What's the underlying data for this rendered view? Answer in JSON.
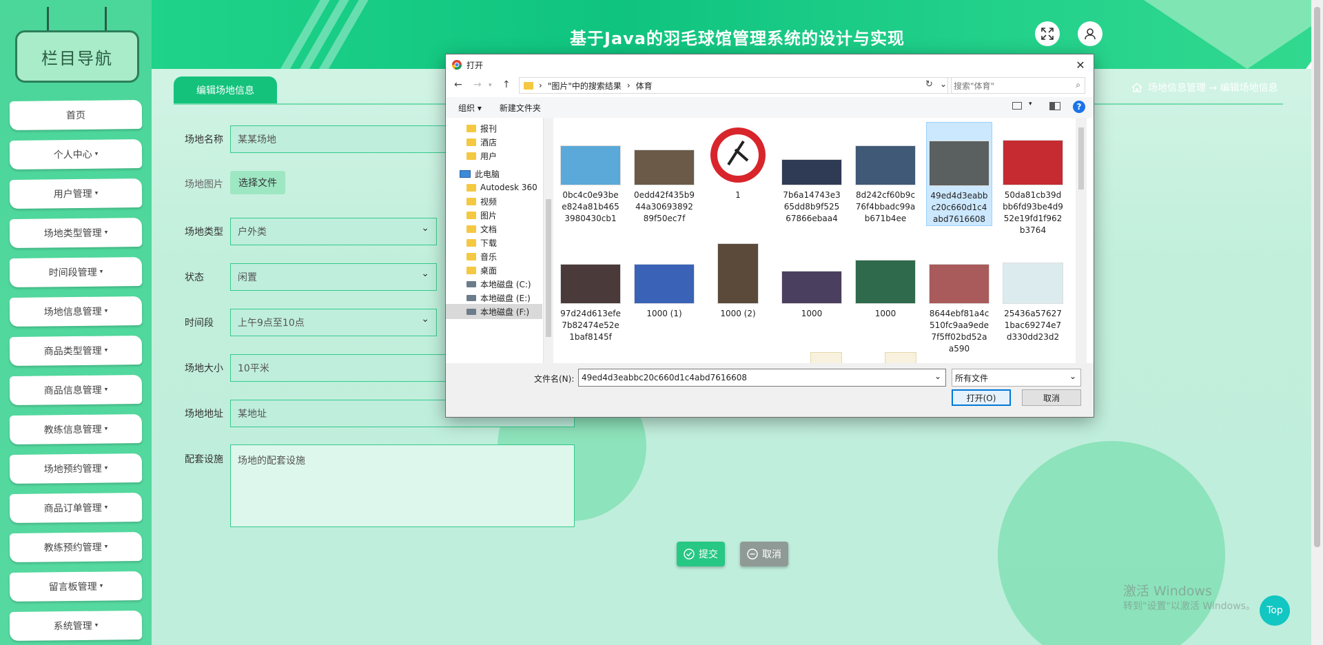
{
  "app": {
    "title": "基于Java的羽毛球馆管理系统的设计与实现"
  },
  "sidebar": {
    "heading": "栏目导航",
    "items": [
      {
        "label": "首页",
        "has_caret": false
      },
      {
        "label": "个人中心",
        "has_caret": true
      },
      {
        "label": "用户管理",
        "has_caret": true
      },
      {
        "label": "场地类型管理",
        "has_caret": true
      },
      {
        "label": "时间段管理",
        "has_caret": true
      },
      {
        "label": "场地信息管理",
        "has_caret": true
      },
      {
        "label": "商品类型管理",
        "has_caret": true
      },
      {
        "label": "商品信息管理",
        "has_caret": true
      },
      {
        "label": "教练信息管理",
        "has_caret": true
      },
      {
        "label": "场地预约管理",
        "has_caret": true
      },
      {
        "label": "商品订单管理",
        "has_caret": true
      },
      {
        "label": "教练预约管理",
        "has_caret": true
      },
      {
        "label": "留言板管理",
        "has_caret": true
      },
      {
        "label": "系统管理",
        "has_caret": true
      }
    ],
    "caret": "▾"
  },
  "tab": {
    "label": "编辑场地信息"
  },
  "breadcrumb": {
    "text": "场地信息管理 → 编辑场地信息"
  },
  "form": {
    "name_label": "场地名称",
    "name_value": "某某场地",
    "image_label": "场地图片",
    "file_button": "选择文件",
    "type_label": "场地类型",
    "type_value": "户外类",
    "status_label": "状态",
    "status_value": "闲置",
    "time_label": "时间段",
    "time_value": "上午9点至10点",
    "size_label": "场地大小",
    "size_value": "10平米",
    "address_label": "场地地址",
    "address_value": "某地址",
    "facilities_label": "配套设施",
    "facilities_value": "场地的配套设施",
    "submit": "提交",
    "cancel": "取消"
  },
  "watermark": {
    "line1": "激活 Windows",
    "line2": "转到\"设置\"以激活 Windows。"
  },
  "top_button": "Top",
  "dialog": {
    "title": "打开",
    "path": [
      "\"图片\"中的搜索结果",
      "体育"
    ],
    "search_placeholder": "搜索\"体育\"",
    "toolbar": {
      "organize": "组织 ▾",
      "new_folder": "新建文件夹"
    },
    "tree": [
      "报刊",
      "酒店",
      "用户",
      "此电脑",
      "Autodesk 360",
      "视频",
      "图片",
      "文档",
      "下载",
      "音乐",
      "桌面",
      "本地磁盘 (C:)",
      "本地磁盘 (E:)",
      "本地磁盘 (F:)"
    ],
    "files": [
      {
        "name": "0bc4c0e93bee824a81b4653980430cb1",
        "color": "#5aa9d8"
      },
      {
        "name": "0edd42f435b944a3069389289f50ec7f",
        "color": "#6b5a48"
      },
      {
        "name": "1",
        "color": "#d8252b"
      },
      {
        "name": "7b6a14743e365dd8b9f52567866ebaa4",
        "color": "#2f3b55"
      },
      {
        "name": "8d242cf60b9c76f4bbadc99ab671b4ee",
        "color": "#3f5977"
      },
      {
        "name": "49ed4d3eabbc20c660d1c4abd7616608",
        "color": "#59605f"
      },
      {
        "name": "50da81cb39dbb6fd93be4d952e19fd1f962b3764",
        "color": "#c52b30"
      },
      {
        "name": "97d24d613efe7b82474e52e1baf8145f",
        "color": "#4a3a3a"
      },
      {
        "name": "1000 (1)",
        "color": "#3a63b8"
      },
      {
        "name": "1000 (2)",
        "color": "#5b4a3a"
      },
      {
        "name": "1000",
        "color": "#4a3f5f"
      },
      {
        "name": "1000",
        "color": "#2e6a4b"
      },
      {
        "name": "8644ebf81a4c510fc9aa9ede7f5ff02bd52aa590",
        "color": "#a95a5a"
      },
      {
        "name": "25436a576271bac69274e7d330dd23d2",
        "color": "#dcecee"
      }
    ],
    "filename_label": "文件名(N):",
    "filename_value": "49ed4d3eabbc20c660d1c4abd7616608",
    "filetype": "所有文件",
    "open": "打开(O)",
    "cancel": "取消"
  },
  "colors": {
    "brand": "#14c27c",
    "header": "#1fd38a",
    "sidebar": "#4bd69a"
  }
}
